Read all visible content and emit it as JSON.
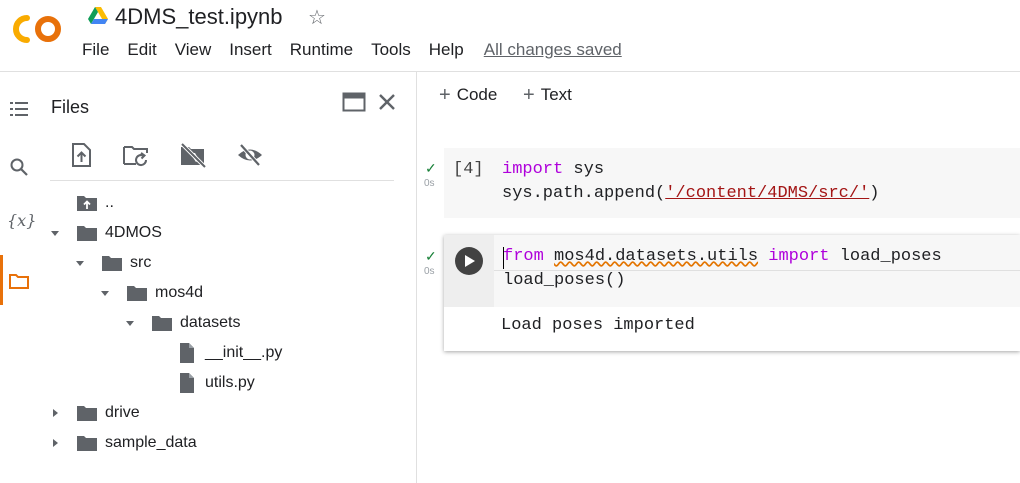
{
  "header": {
    "title": "4DMS_test.ipynb",
    "logo_text": "CO",
    "menu": [
      "File",
      "Edit",
      "View",
      "Insert",
      "Runtime",
      "Tools",
      "Help"
    ],
    "save_status": "All changes saved"
  },
  "rail": {
    "icons": [
      "toc-icon",
      "search-icon",
      "variables-icon",
      "folder-icon"
    ],
    "variables_label": "{x}",
    "active": "folder-icon"
  },
  "files_panel": {
    "title": "Files",
    "tree": [
      {
        "label": "..",
        "type": "parent",
        "depth": 0,
        "expanded": null
      },
      {
        "label": "4DMOS",
        "type": "folder",
        "depth": 0,
        "expanded": true
      },
      {
        "label": "src",
        "type": "folder",
        "depth": 1,
        "expanded": true
      },
      {
        "label": "mos4d",
        "type": "folder",
        "depth": 2,
        "expanded": true
      },
      {
        "label": "datasets",
        "type": "folder",
        "depth": 3,
        "expanded": true
      },
      {
        "label": "__init__.py",
        "type": "file",
        "depth": 4,
        "expanded": null
      },
      {
        "label": "utils.py",
        "type": "file",
        "depth": 4,
        "expanded": null
      },
      {
        "label": "drive",
        "type": "folder",
        "depth": 0,
        "expanded": false
      },
      {
        "label": "sample_data",
        "type": "folder",
        "depth": 0,
        "expanded": false
      }
    ]
  },
  "notebook": {
    "add_code_label": "Code",
    "add_text_label": "Text",
    "cells": [
      {
        "exec_count": "[4]",
        "time": "0s",
        "line1": {
          "kw": "import",
          "rest": " sys"
        },
        "line2": {
          "pre": "sys.path.append(",
          "str": "'/content/4DMS/src/'",
          "post": ")"
        }
      },
      {
        "time": "0s",
        "line1": {
          "kw1": "from",
          "mod": "mos4d.datasets.utils",
          "kw2": "import",
          "rest": "load_poses"
        },
        "line2": "load_poses()",
        "output": "Load poses imported"
      }
    ]
  },
  "colors": {
    "accent": "#e8710a",
    "keyword": "#af00db",
    "string": "#a31515",
    "success": "#188038"
  }
}
